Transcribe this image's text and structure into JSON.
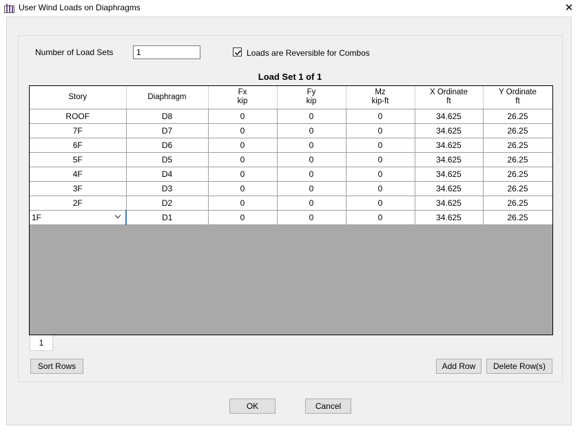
{
  "window": {
    "title": "User Wind Loads on Diaphragms",
    "close_glyph": "✕"
  },
  "number_of_load_sets": {
    "label": "Number of Load Sets",
    "value": "1"
  },
  "reversible": {
    "label": "Loads are Reversible for Combos",
    "checked": true
  },
  "load_set_title": "Load Set 1 of 1",
  "table": {
    "columns": [
      {
        "line1": "Story",
        "line2": ""
      },
      {
        "line1": "Diaphragm",
        "line2": ""
      },
      {
        "line1": "Fx",
        "line2": "kip"
      },
      {
        "line1": "Fy",
        "line2": "kip"
      },
      {
        "line1": "Mz",
        "line2": "kip-ft"
      },
      {
        "line1": "X Ordinate",
        "line2": "ft"
      },
      {
        "line1": "Y Ordinate",
        "line2": "ft"
      }
    ],
    "rows": [
      [
        "ROOF",
        "D8",
        "0",
        "0",
        "0",
        "34.625",
        "26.25"
      ],
      [
        "7F",
        "D7",
        "0",
        "0",
        "0",
        "34.625",
        "26.25"
      ],
      [
        "6F",
        "D6",
        "0",
        "0",
        "0",
        "34.625",
        "26.25"
      ],
      [
        "5F",
        "D5",
        "0",
        "0",
        "0",
        "34.625",
        "26.25"
      ],
      [
        "4F",
        "D4",
        "0",
        "0",
        "0",
        "34.625",
        "26.25"
      ],
      [
        "3F",
        "D3",
        "0",
        "0",
        "0",
        "34.625",
        "26.25"
      ],
      [
        "2F",
        "D2",
        "0",
        "0",
        "0",
        "34.625",
        "26.25"
      ],
      [
        "1F",
        "D1",
        "0",
        "0",
        "0",
        "34.625",
        "26.25"
      ]
    ]
  },
  "page_tab": "1",
  "buttons": {
    "sort_rows": "Sort Rows",
    "add_row": "Add Row",
    "delete_rows": "Delete Row(s)",
    "ok": "OK",
    "cancel": "Cancel"
  },
  "icons": {
    "app": "etabs-app-icon",
    "checkbox": "check-icon",
    "dropdown": "chevron-down-icon"
  }
}
